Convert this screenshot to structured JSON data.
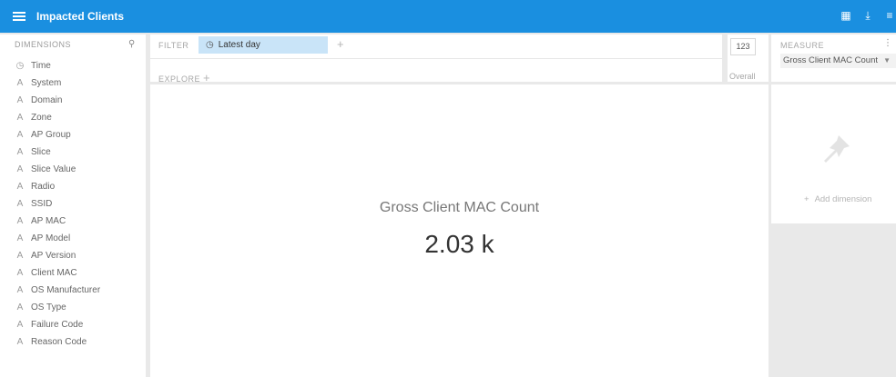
{
  "header": {
    "title": "Impacted Clients",
    "actions": [
      {
        "icon": "layout-icon",
        "glyph": "▦"
      },
      {
        "icon": "download-icon",
        "glyph": "⤓"
      },
      {
        "icon": "more-icon",
        "glyph": "≡"
      }
    ]
  },
  "sidebar": {
    "heading": "DIMENSIONS",
    "items": [
      {
        "label": "Time",
        "icon": "clock-icon",
        "glyph": "◷"
      },
      {
        "label": "System",
        "icon": "string-dimension-icon",
        "glyph": "A"
      },
      {
        "label": "Domain",
        "icon": "string-dimension-icon",
        "glyph": "A"
      },
      {
        "label": "Zone",
        "icon": "string-dimension-icon",
        "glyph": "A"
      },
      {
        "label": "AP Group",
        "icon": "string-dimension-icon",
        "glyph": "A"
      },
      {
        "label": "Slice",
        "icon": "string-dimension-icon",
        "glyph": "A"
      },
      {
        "label": "Slice Value",
        "icon": "string-dimension-icon",
        "glyph": "A"
      },
      {
        "label": "Radio",
        "icon": "string-dimension-icon",
        "glyph": "A"
      },
      {
        "label": "SSID",
        "icon": "string-dimension-icon",
        "glyph": "A"
      },
      {
        "label": "AP MAC",
        "icon": "string-dimension-icon",
        "glyph": "A"
      },
      {
        "label": "AP Model",
        "icon": "string-dimension-icon",
        "glyph": "A"
      },
      {
        "label": "AP Version",
        "icon": "string-dimension-icon",
        "glyph": "A"
      },
      {
        "label": "Client MAC",
        "icon": "string-dimension-icon",
        "glyph": "A"
      },
      {
        "label": "OS Manufacturer",
        "icon": "string-dimension-icon",
        "glyph": "A"
      },
      {
        "label": "OS Type",
        "icon": "string-dimension-icon",
        "glyph": "A"
      },
      {
        "label": "Failure Code",
        "icon": "string-dimension-icon",
        "glyph": "A"
      },
      {
        "label": "Reason Code",
        "icon": "string-dimension-icon",
        "glyph": "A"
      }
    ]
  },
  "filter": {
    "label": "FILTER",
    "chip_label": "Latest day",
    "explore_label": "EXPLORE"
  },
  "overall": {
    "number": "123",
    "label": "Overall"
  },
  "measure": {
    "label": "MEASURE",
    "selected": "Gross Client MAC Count"
  },
  "visualization": {
    "metric_title": "Gross Client MAC Count",
    "metric_value": "2.03 k"
  },
  "pinboard": {
    "add_dimension": "Add dimension"
  },
  "colors": {
    "accent": "#1a8fe0",
    "chip": "#c9e4f8",
    "background": "#e9e9e9"
  }
}
